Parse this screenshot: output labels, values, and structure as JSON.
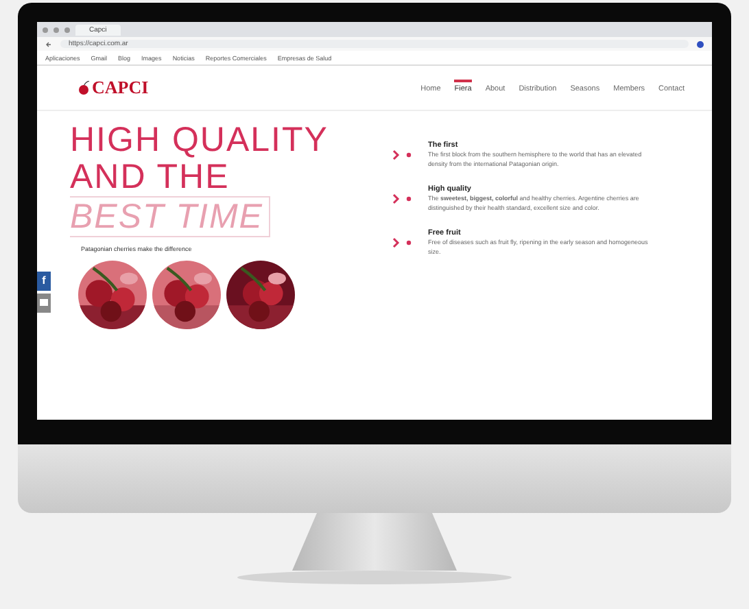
{
  "browser": {
    "tab_title": "Capci",
    "url": "https://capci.com.ar",
    "bookmarks": [
      "Aplicaciones",
      "Gmail",
      "Blog",
      "Images",
      "Noticias",
      "Reportes Comerciales",
      "Empresas de Salud"
    ]
  },
  "site": {
    "logo": "CAPCI",
    "nav": [
      {
        "label": "Home",
        "selected": false
      },
      {
        "label": "Fiera",
        "selected": true
      },
      {
        "label": "About",
        "selected": false
      },
      {
        "label": "Distribution",
        "selected": false
      },
      {
        "label": "Seasons",
        "selected": false
      },
      {
        "label": "Members",
        "selected": false
      },
      {
        "label": "Contact",
        "selected": false
      }
    ],
    "hero": {
      "line1": "HIGH QUALITY",
      "line2": "AND THE",
      "line3": "BEST TIME",
      "tagline": "Patagonian cherries make the difference"
    },
    "social": [
      {
        "kind": "facebook",
        "label": "f"
      },
      {
        "kind": "mail"
      }
    ],
    "features": [
      {
        "title": "The first",
        "text": "The first block from the southern hemisphere to the world that has an elevated density from the international Patagonian origin."
      },
      {
        "title": "High quality",
        "text": "The **sweetest, biggest, colorful** and healthy cherries. Argentine cherries are distinguished by their health standard, excellent size and color."
      },
      {
        "title": "Free fruit",
        "text": "Free of diseases such as fruit fly, ripening in the early season and homogeneous size."
      }
    ]
  }
}
